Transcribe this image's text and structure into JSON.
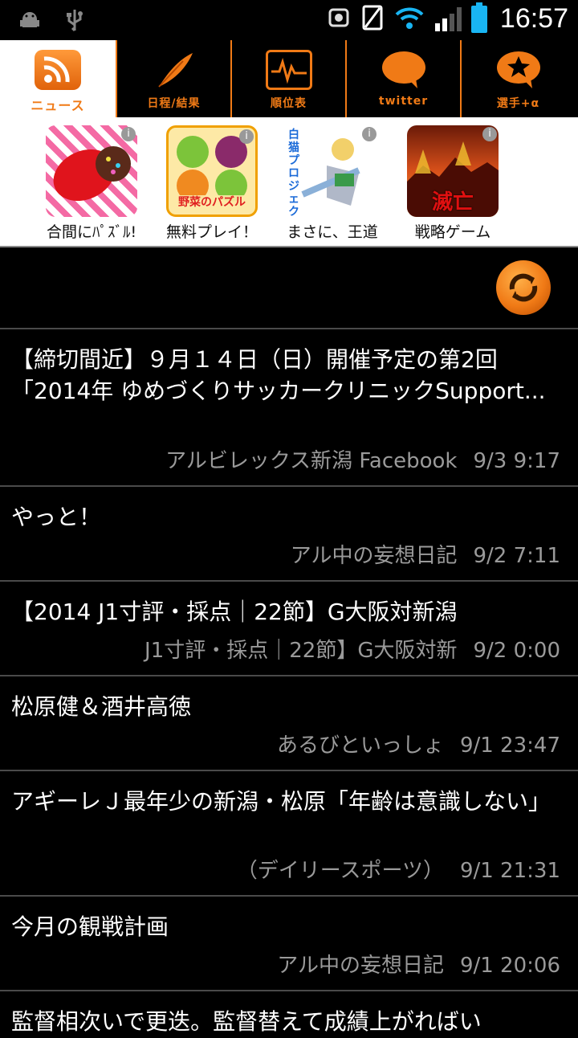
{
  "status": {
    "time": "16:57"
  },
  "tabs": [
    {
      "label": "ニュース",
      "icon": "rss-icon"
    },
    {
      "label": "日程/結果",
      "icon": "feather-icon"
    },
    {
      "label": "順位表",
      "icon": "ranking-icon"
    },
    {
      "label": "twitter",
      "icon": "speech-bubble-icon"
    },
    {
      "label": "選手+α",
      "icon": "star-bubble-icon"
    }
  ],
  "ads": [
    {
      "caption": "合間にﾊﾟｽﾞﾙ!"
    },
    {
      "caption": "無料プレイ！",
      "art_text": "野菜のパズル"
    },
    {
      "caption": "まさに、王道",
      "art_text": "白猫プロジェクト"
    },
    {
      "caption": "戦略ゲーム",
      "art_text": "滅亡"
    }
  ],
  "news": [
    {
      "title": "【締切間近】９月１４日（日）開催予定の第2回「2014年 ゆめづくりサッカークリニックSupport...",
      "source": "アルビレックス新潟 Facebook",
      "time": "9/3 9:17"
    },
    {
      "title": "やっと！",
      "source": "アル中の妄想日記",
      "time": "9/2 7:11"
    },
    {
      "title": "【2014 J1寸評・採点｜22節】G大阪対新潟",
      "source": "J1寸評・採点｜22節】G大阪対新",
      "time": "9/2 0:00"
    },
    {
      "title": "松原健＆酒井高徳",
      "source": "あるびといっしょ",
      "time": "9/1 23:47"
    },
    {
      "title": "アギーレＪ最年少の新潟・松原「年齢は意識しない」",
      "source": "（デイリースポーツ）",
      "time": "9/1 21:31"
    },
    {
      "title": "今月の観戦計画",
      "source": "アル中の妄想日記",
      "time": "9/1 20:06"
    },
    {
      "title": "監督相次いで更迭。監督替えて成績上がればい",
      "source": "",
      "time": ""
    }
  ],
  "colors": {
    "accent": "#f07a16",
    "background": "#000000",
    "meta": "#9a9a9a"
  }
}
